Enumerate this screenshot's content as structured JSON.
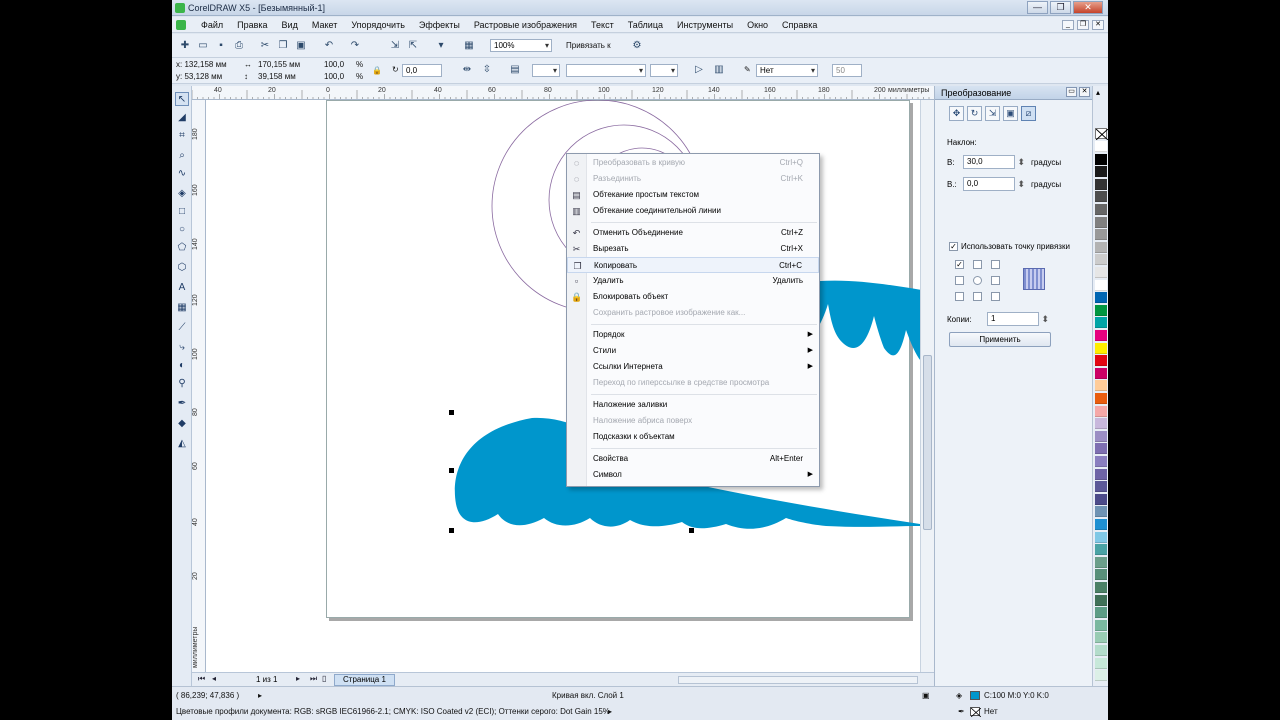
{
  "window": {
    "title": "CorelDRAW X5 - [Безымянный-1]",
    "buttons": [
      "—",
      "❐",
      "✕"
    ]
  },
  "menubar": [
    "Файл",
    "Правка",
    "Вид",
    "Макет",
    "Упорядочить",
    "Эффекты",
    "Растровые изображения",
    "Текст",
    "Таблица",
    "Инструменты",
    "Окно",
    "Справка"
  ],
  "toolbar1": {
    "zoom": "100%",
    "snap": "Привязать к"
  },
  "propbar": {
    "x": "x: 132,158 мм",
    "y": "y: 53,128 мм",
    "width": "170,155 мм",
    "height": "39,158 мм",
    "scale_w": "100,0",
    "scale_h": "100,0",
    "pct": "%",
    "angle": "0,0",
    "outline": "Нет",
    "num": "50"
  },
  "rulers": {
    "top_labels": [
      "40",
      "20",
      "0",
      "20",
      "40",
      "60",
      "80",
      "100",
      "120",
      "140",
      "160",
      "180",
      "200",
      "миллиметры"
    ],
    "left_labels": [
      "180",
      "160",
      "140",
      "120",
      "100",
      "80",
      "60",
      "40",
      "20",
      "миллиметры"
    ]
  },
  "context_menu": {
    "items": [
      {
        "icon": "convert-curve-icon",
        "glyph": "◌",
        "label": "Преобразовать в кривую",
        "shortcut": "Ctrl+Q",
        "disabled": true
      },
      {
        "icon": "break-apart-icon",
        "glyph": "◌",
        "label": "Разъединить",
        "shortcut": "Ctrl+K",
        "disabled": true
      },
      {
        "icon": "wrap-text-icon",
        "glyph": "▤",
        "label": "Обтекание простым текстом",
        "shortcut": "",
        "disabled": false
      },
      {
        "icon": "connector-wrap-icon",
        "glyph": "▥",
        "label": "Обтекание соединительной линии",
        "shortcut": "",
        "disabled": false
      },
      {
        "sep": true
      },
      {
        "icon": "undo-icon",
        "glyph": "↶",
        "label": "Отменить Объединение",
        "shortcut": "Ctrl+Z",
        "disabled": false
      },
      {
        "icon": "scissors-icon",
        "glyph": "✂",
        "label": "Вырезать",
        "shortcut": "Ctrl+X",
        "disabled": false
      },
      {
        "icon": "copy-icon",
        "glyph": "❐",
        "label": "Копировать",
        "shortcut": "Ctrl+C",
        "disabled": false,
        "highlight": true
      },
      {
        "icon": "delete-icon",
        "glyph": "▫",
        "label": "Удалить",
        "shortcut": "Удалить",
        "disabled": false
      },
      {
        "icon": "lock-icon",
        "glyph": "🔒",
        "label": "Блокировать объект",
        "shortcut": "",
        "disabled": false
      },
      {
        "icon": "",
        "glyph": "",
        "label": "Сохранить растровое изображение как...",
        "shortcut": "",
        "disabled": true
      },
      {
        "sep": true
      },
      {
        "icon": "",
        "glyph": "",
        "label": "Порядок",
        "shortcut": "",
        "disabled": false,
        "submenu": true
      },
      {
        "icon": "",
        "glyph": "",
        "label": "Стили",
        "shortcut": "",
        "disabled": false,
        "submenu": true
      },
      {
        "icon": "",
        "glyph": "",
        "label": "Ссылки Интернета",
        "shortcut": "",
        "disabled": false,
        "submenu": true
      },
      {
        "icon": "",
        "glyph": "",
        "label": "Переход по гиперссылке в средстве просмотра",
        "shortcut": "",
        "disabled": true
      },
      {
        "sep": true
      },
      {
        "icon": "",
        "glyph": "",
        "label": "Наложение заливки",
        "shortcut": "",
        "disabled": false
      },
      {
        "icon": "",
        "glyph": "",
        "label": "Наложение абриса поверх",
        "shortcut": "",
        "disabled": true
      },
      {
        "icon": "",
        "glyph": "",
        "label": "Подсказки к объектам",
        "shortcut": "",
        "disabled": false
      },
      {
        "sep": true
      },
      {
        "icon": "",
        "glyph": "",
        "label": "Свойства",
        "shortcut": "Alt+Enter",
        "disabled": false
      },
      {
        "icon": "",
        "glyph": "",
        "label": "Символ",
        "shortcut": "",
        "disabled": false,
        "submenu": true
      }
    ]
  },
  "docker": {
    "title": "Преобразование",
    "section": "Наклон:",
    "h_label": "В:",
    "h_value": "30,0",
    "v_label": "В.:",
    "v_value": "0,0",
    "units": "градусы",
    "anchor_label": "Использовать точку привязки",
    "copies_label": "Копии:",
    "copies_value": "1",
    "apply": "Применить"
  },
  "pagenav": {
    "count": "1 из 1",
    "tab": "Страница 1"
  },
  "status": {
    "coords": "( 86,239; 47,836 )",
    "object": "Кривая вкл. Слой 1",
    "profile": "Цветовые профили документа: RGB: sRGB IEC61966-2.1; CMYK: ISO Coated v2 (ECI); Оттенки серого: Dot Gain 15%",
    "fill": "C:100 M:0 Y:0 K:0",
    "outline": "Нет"
  },
  "colors": {
    "shape_fill": "#0096cc",
    "spiral_stroke": "#8a6aa0"
  },
  "palette": [
    "#ffffff",
    "#000000",
    "#1a1a1a",
    "#333333",
    "#4d4d4d",
    "#666666",
    "#808080",
    "#999999",
    "#b3b3b3",
    "#cccccc",
    "#e6e6e6",
    "#ffffff",
    "#0066b3",
    "#009640",
    "#00a4a6",
    "#e6007e",
    "#ffed00",
    "#e30613",
    "#cc0066",
    "#ffcc99",
    "#e95d0f",
    "#f5a8a8",
    "#c8b8dc",
    "#9b8ec4",
    "#7e6fb2",
    "#8a7fc0",
    "#6e64a6",
    "#5b5898",
    "#4c4b8a",
    "#6f93b4",
    "#1e90d2",
    "#80c8e6",
    "#4aa3a5",
    "#6b9f8b",
    "#58907a",
    "#4a8066",
    "#3f7058",
    "#5c9c86",
    "#7ab8a0",
    "#99ccb4",
    "#b3dccb",
    "#c7e8da",
    "#dcf0e7"
  ]
}
